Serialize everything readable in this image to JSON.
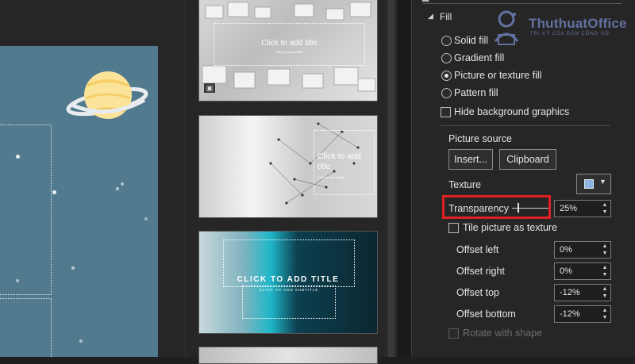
{
  "slide_canvas": {
    "background": "#527a8e"
  },
  "thumbnails": [
    {
      "title": "Click to add title",
      "subtitle": "Click to add subtitle"
    },
    {
      "title": "Click to add title",
      "subtitle": "Click to add subtitle"
    },
    {
      "title": "CLICK TO ADD TITLE",
      "subtitle": "CLICK TO ADD SUBTITLE"
    }
  ],
  "format_pane": {
    "section_title": "Fill",
    "fill_options": [
      {
        "label": "Solid fill",
        "selected": false
      },
      {
        "label": "Gradient fill",
        "selected": false
      },
      {
        "label": "Picture or texture fill",
        "selected": true
      },
      {
        "label": "Pattern fill",
        "selected": false
      }
    ],
    "hide_background_label": "Hide background graphics",
    "picture_source_label": "Picture source",
    "insert_button": "Insert...",
    "clipboard_button": "Clipboard",
    "texture_label": "Texture",
    "transparency_label": "Transparency",
    "transparency_value": "25%",
    "tile_label": "Tile picture as texture",
    "offsets": [
      {
        "label": "Offset left",
        "value": "0%"
      },
      {
        "label": "Offset right",
        "value": "0%"
      },
      {
        "label": "Offset top",
        "value": "-12%"
      },
      {
        "label": "Offset bottom",
        "value": "-12%"
      }
    ],
    "rotate_label": "Rotate with shape",
    "highlight_color": "#e02020"
  },
  "watermark": {
    "brand": "ThuthuatOffice",
    "tagline": "TRI KỸ CỦA DÂN CÔNG SỞ"
  }
}
